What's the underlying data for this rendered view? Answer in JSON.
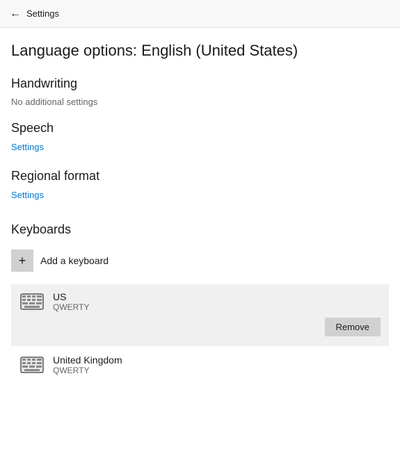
{
  "header": {
    "back_label": "Settings",
    "back_arrow": "←"
  },
  "page": {
    "title": "Language options: English (United States)"
  },
  "sections": {
    "handwriting": {
      "heading": "Handwriting",
      "sub_text": "No additional settings"
    },
    "speech": {
      "heading": "Speech",
      "settings_link": "Settings"
    },
    "regional_format": {
      "heading": "Regional format",
      "settings_link": "Settings"
    },
    "keyboards": {
      "heading": "Keyboards",
      "add_label": "Add a keyboard",
      "add_icon": "+",
      "items": [
        {
          "name": "US",
          "type": "QWERTY",
          "show_remove": true
        },
        {
          "name": "United Kingdom",
          "type": "QWERTY",
          "show_remove": false
        }
      ],
      "remove_label": "Remove"
    }
  }
}
